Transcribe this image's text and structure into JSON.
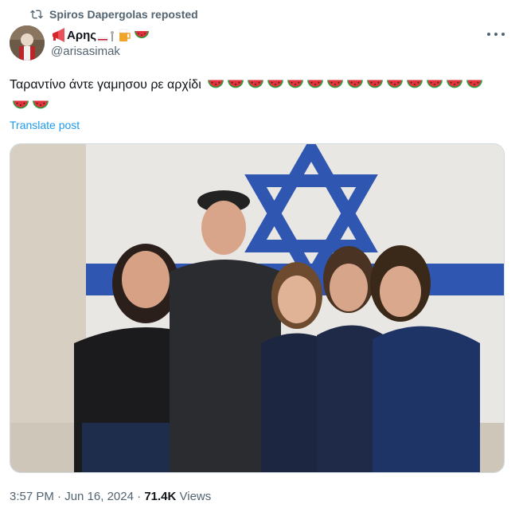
{
  "repost": {
    "label": "Spiros Dapergolas reposted",
    "icon": "repost-icon"
  },
  "author": {
    "display_name": "Αρης",
    "handle": "@arisasimak",
    "avatar_icon": "avatar-photo"
  },
  "tweet": {
    "text": "Ταραντίνο άντε γαμησου ρε αρχίδι",
    "emoji_name": "watermelon",
    "emoji_count": 16,
    "translate_label": "Translate post"
  },
  "media": {
    "description_icon": "group-photo"
  },
  "meta": {
    "time": "3:57 PM",
    "separator": "·",
    "date": "Jun 16, 2024",
    "views_count": "71.4K",
    "views_label": "Views"
  },
  "colors": {
    "text_primary": "#0f1419",
    "text_secondary": "#536471",
    "link": "#1d9bf0",
    "border": "#cfd9de",
    "flag_blue": "#2f56b0"
  }
}
